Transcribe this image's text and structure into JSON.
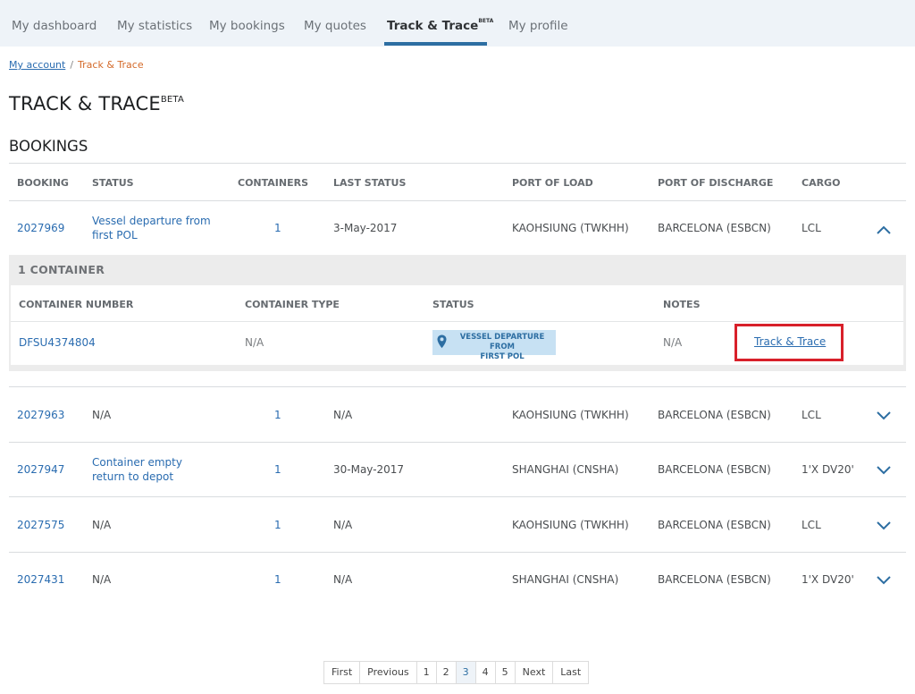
{
  "nav": {
    "tabs": [
      {
        "label": "My dashboard"
      },
      {
        "label": "My statistics"
      },
      {
        "label": "My bookings"
      },
      {
        "label": "My quotes"
      },
      {
        "label": "Track & Trace",
        "badge": "BETA",
        "active": true
      },
      {
        "label": "My profile"
      }
    ]
  },
  "breadcrumb": {
    "root": "My account",
    "separator": "/",
    "current": "Track & Trace"
  },
  "page": {
    "title": "TRACK & TRACE",
    "title_badge": "BETA",
    "section": "BOOKINGS"
  },
  "table": {
    "headers": {
      "booking": "BOOKING",
      "status": "STATUS",
      "containers": "CONTAINERS",
      "last_status": "LAST STATUS",
      "port_load": "PORT OF LOAD",
      "port_discharge": "PORT OF DISCHARGE",
      "cargo": "CARGO"
    },
    "rows": [
      {
        "booking": "2027969",
        "status": "Vessel departure from first POL",
        "containers": "1",
        "last_status": "3-May-2017",
        "port_load": "KAOHSIUNG (TWKHH)",
        "port_discharge": "BARCELONA (ESBCN)",
        "cargo": "LCL",
        "expanded": true
      },
      {
        "booking": "2027963",
        "status": "N/A",
        "containers": "1",
        "last_status": "N/A",
        "port_load": "KAOHSIUNG (TWKHH)",
        "port_discharge": "BARCELONA (ESBCN)",
        "cargo": "LCL",
        "expanded": false
      },
      {
        "booking": "2027947",
        "status": "Container empty return to depot",
        "containers": "1",
        "last_status": "30-May-2017",
        "port_load": "SHANGHAI (CNSHA)",
        "port_discharge": "BARCELONA (ESBCN)",
        "cargo": "1'X DV20'",
        "expanded": false
      },
      {
        "booking": "2027575",
        "status": "N/A",
        "containers": "1",
        "last_status": "N/A",
        "port_load": "KAOHSIUNG (TWKHH)",
        "port_discharge": "BARCELONA (ESBCN)",
        "cargo": "LCL",
        "expanded": false
      },
      {
        "booking": "2027431",
        "status": "N/A",
        "containers": "1",
        "last_status": "N/A",
        "port_load": "SHANGHAI (CNSHA)",
        "port_discharge": "BARCELONA (ESBCN)",
        "cargo": "1'X DV20'",
        "expanded": false
      }
    ]
  },
  "container_panel": {
    "title": "1 CONTAINER",
    "headers": {
      "number": "CONTAINER NUMBER",
      "type": "CONTAINER TYPE",
      "status": "STATUS",
      "notes": "NOTES"
    },
    "row": {
      "number": "DFSU4374804",
      "type": "N/A",
      "status_line1": "VESSEL DEPARTURE FROM",
      "status_line2": "FIRST POL",
      "notes": "N/A",
      "action": "Track & Trace"
    }
  },
  "pagination": {
    "first": "First",
    "previous": "Previous",
    "pages": [
      "1",
      "2",
      "3",
      "4",
      "5"
    ],
    "current": "3",
    "next": "Next",
    "last": "Last"
  },
  "colors": {
    "accent": "#2d6ea2",
    "link": "#2a6cb0",
    "breadcrumb_current": "#d46a2a",
    "highlight": "#d8202a",
    "badge_bg": "#c7e1f3"
  },
  "icons": {
    "expanded_row": "chevron-up-icon",
    "collapsed_row": "chevron-down-icon",
    "status": "location-pin-icon"
  }
}
